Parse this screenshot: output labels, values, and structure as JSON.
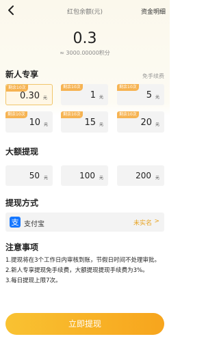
{
  "header": {
    "title": "红包余额(元)",
    "right_link": "资金明细"
  },
  "balance": {
    "amount": "0.3",
    "points": "≈ 3000.00000积分"
  },
  "newbie": {
    "title": "新人专享",
    "note": "免手续费",
    "options": [
      {
        "badge": "剩余10次",
        "amount": "0.30",
        "unit": "元",
        "selected": true
      },
      {
        "badge": "剩余10次",
        "amount": "1",
        "unit": "元",
        "selected": false
      },
      {
        "badge": "剩余10次",
        "amount": "5",
        "unit": "元",
        "selected": false
      },
      {
        "badge": "剩余10次",
        "amount": "10",
        "unit": "元",
        "selected": false
      },
      {
        "badge": "剩余10次",
        "amount": "15",
        "unit": "元",
        "selected": false
      },
      {
        "badge": "剩余10次",
        "amount": "20",
        "unit": "元",
        "selected": false
      }
    ]
  },
  "large": {
    "title": "大额提现",
    "options": [
      {
        "amount": "50",
        "unit": "元"
      },
      {
        "amount": "100",
        "unit": "元"
      },
      {
        "amount": "200",
        "unit": "元"
      }
    ]
  },
  "withdraw_method": {
    "title": "提现方式",
    "name": "支付宝",
    "status": "未实名",
    "chevron": ">",
    "brand_color": "#1677ff"
  },
  "notes": {
    "title": "注意事项",
    "items": [
      "1.提现将在3个工作日内审核到账，节假日时间不处理审批。",
      "2.新人专享提现免手续费，大额提现提现手续费为3%。",
      "3.每日提现上限7次。"
    ]
  },
  "submit": {
    "label": "立即提现"
  }
}
